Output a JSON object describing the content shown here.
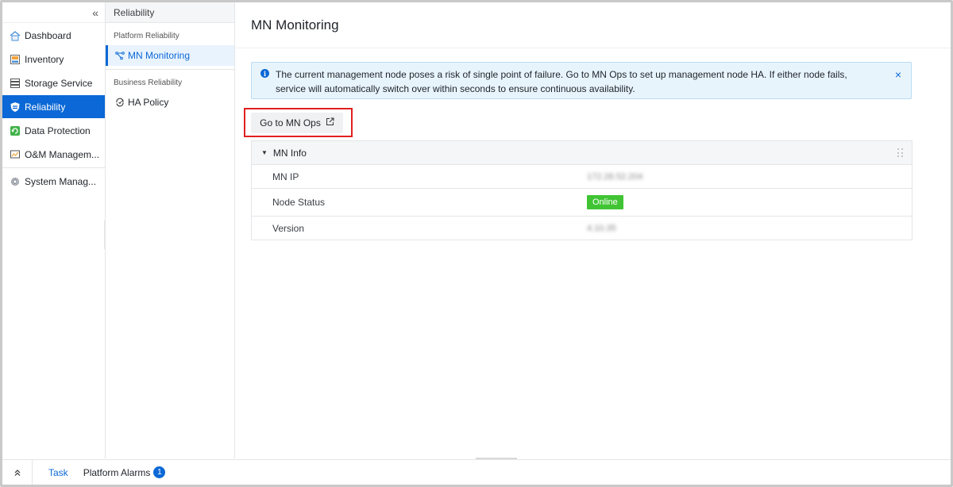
{
  "nav": {
    "collapse_glyph": "«",
    "items": [
      {
        "label": "Dashboard",
        "icon": "home-icon"
      },
      {
        "label": "Inventory",
        "icon": "inventory-icon"
      },
      {
        "label": "Storage Service",
        "icon": "storage-icon"
      },
      {
        "label": "Reliability",
        "icon": "shield-icon",
        "active": true
      },
      {
        "label": "Data Protection",
        "icon": "data-protection-icon"
      },
      {
        "label": "O&M Managem...",
        "icon": "om-icon"
      },
      {
        "label": "System Manag...",
        "icon": "gear-icon"
      }
    ]
  },
  "subnav": {
    "title": "Reliability",
    "groups": [
      {
        "label": "Platform Reliability",
        "items": [
          {
            "label": "MN Monitoring",
            "icon": "topology-icon",
            "active": true
          }
        ]
      },
      {
        "label": "Business Reliability",
        "items": [
          {
            "label": "HA Policy",
            "icon": "ha-policy-icon"
          }
        ]
      }
    ]
  },
  "main": {
    "title": "MN Monitoring",
    "alert": {
      "text": "The current management node poses a risk of single point of failure. Go to MN Ops to set up management node HA. If either node fails, service will automatically switch over within seconds to ensure continuous availability.",
      "close_glyph": "×"
    },
    "button": {
      "label": "Go to MN Ops",
      "icon": "external-link-icon"
    },
    "panel": {
      "title": "MN Info",
      "rows": [
        {
          "label": "MN IP",
          "value": "172.28.52.204"
        },
        {
          "label": "Node Status",
          "value": "Online"
        },
        {
          "label": "Version",
          "value": "4.10.35"
        }
      ]
    }
  },
  "bottom": {
    "task": "Task",
    "alarms": "Platform Alarms",
    "alarm_count": "1"
  },
  "colors": {
    "accent": "#0b68d6",
    "online": "#41c434",
    "highlight": "#e02020"
  }
}
